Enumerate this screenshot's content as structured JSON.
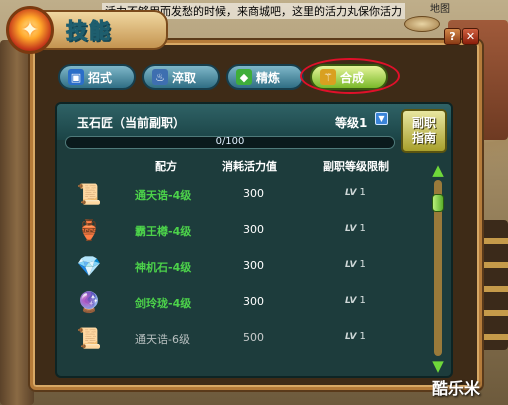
{
  "notice": "活力不够用而发愁的时候，来商城吧，这里的活力丸保你活力",
  "map_label": "地图",
  "window": {
    "title": "技能",
    "help_label": "?",
    "close_label": "✕"
  },
  "tabs": [
    {
      "label": "招式",
      "icon": "move-icon",
      "active": false
    },
    {
      "label": "淬取",
      "icon": "extract-icon",
      "active": false
    },
    {
      "label": "精炼",
      "icon": "refine-icon",
      "active": false
    },
    {
      "label": "合成",
      "icon": "craft-icon",
      "active": true
    }
  ],
  "profession": {
    "title": "玉石匠（当前副职）",
    "level": "等级1",
    "guide_label_1": "副职",
    "guide_label_2": "指南",
    "progress_text": "0/100",
    "progress_fraction": 0
  },
  "columns": {
    "recipe": "配方",
    "cost": "消耗活力值",
    "limit": "副职等级限制"
  },
  "recipes": [
    {
      "name": "通天诰-4级",
      "cost": "300",
      "limit_prefix": "LV",
      "limit": "1",
      "available": true,
      "icon": "scroll-icon",
      "glyph": "📜"
    },
    {
      "name": "霸王樽-4级",
      "cost": "300",
      "limit_prefix": "LV",
      "limit": "1",
      "available": true,
      "icon": "cup-icon",
      "glyph": "🏺"
    },
    {
      "name": "神机石-4级",
      "cost": "300",
      "limit_prefix": "LV",
      "limit": "1",
      "available": true,
      "icon": "crystal-icon",
      "glyph": "💎"
    },
    {
      "name": "剑玲珑-4级",
      "cost": "300",
      "limit_prefix": "LV",
      "limit": "1",
      "available": true,
      "icon": "jade-icon",
      "glyph": "🔮"
    },
    {
      "name": "通天诰-6级",
      "cost": "500",
      "limit_prefix": "LV",
      "limit": "1",
      "available": false,
      "icon": "scroll-icon",
      "glyph": "📜"
    }
  ],
  "watermark": "酷乐米"
}
